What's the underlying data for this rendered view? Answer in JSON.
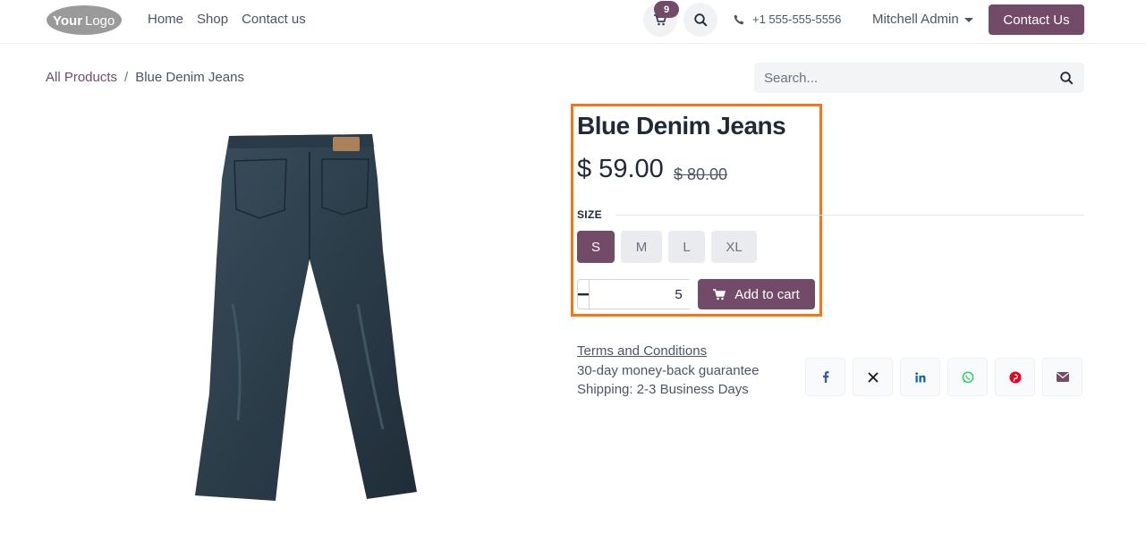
{
  "header": {
    "logo_text": "YourLogo",
    "nav": [
      "Home",
      "Shop",
      "Contact us"
    ],
    "cart_count": "9",
    "phone": "+1 555-555-5556",
    "user": "Mitchell Admin",
    "contact_button": "Contact Us"
  },
  "breadcrumb": {
    "parent": "All Products",
    "separator": "/",
    "current": "Blue Denim Jeans"
  },
  "search": {
    "placeholder": "Search..."
  },
  "product": {
    "title": "Blue Denim Jeans",
    "price": "$ 59.00",
    "old_price": "$ 80.00",
    "size_label": "SIZE",
    "sizes": [
      "S",
      "M",
      "L",
      "XL"
    ],
    "selected_size": "S",
    "quantity": "5",
    "add_to_cart": "Add to cart",
    "terms": "Terms and Conditions",
    "guarantee": "30-day money-back guarantee",
    "shipping": "Shipping: 2-3 Business Days"
  },
  "share": [
    "facebook-icon",
    "x-icon",
    "linkedin-icon",
    "whatsapp-icon",
    "pinterest-icon",
    "envelope-icon"
  ],
  "colors": {
    "brand": "#714b67",
    "highlight": "#f97316"
  }
}
